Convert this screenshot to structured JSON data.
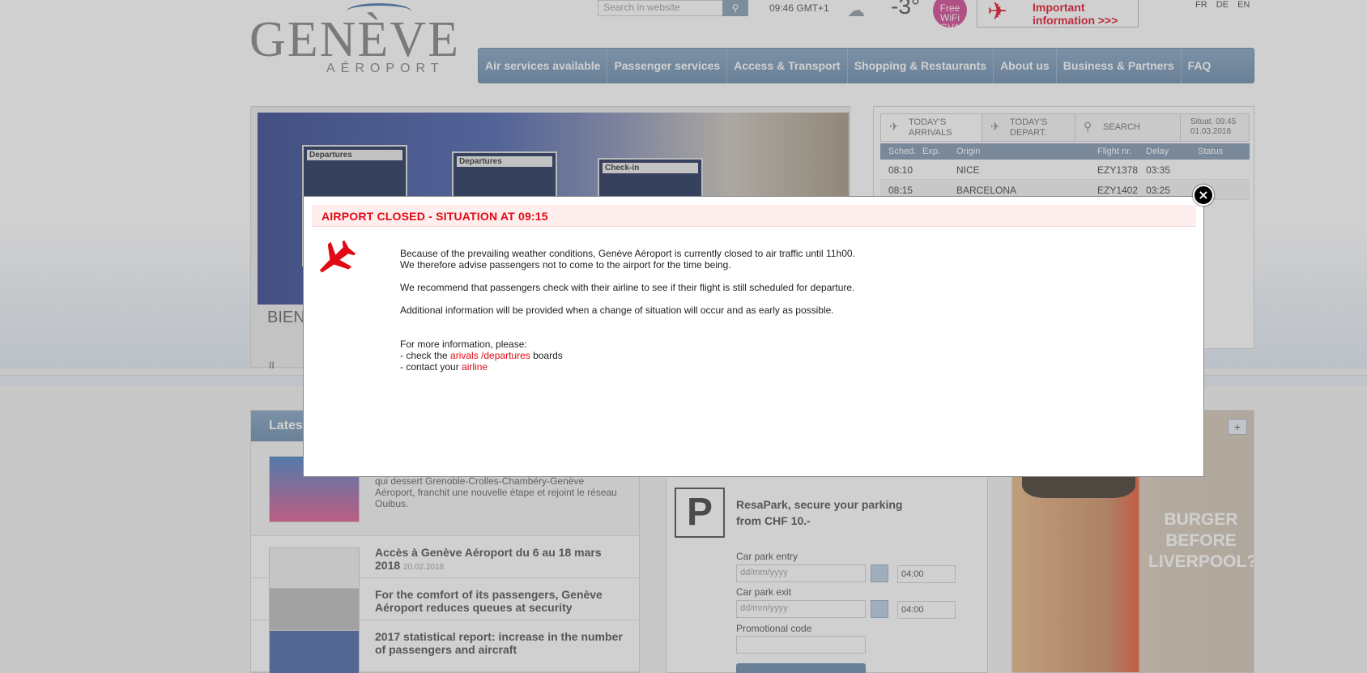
{
  "header": {
    "logo_main": "GENÈVE",
    "logo_sub": "AÉROPORT",
    "search_placeholder": "Search in website",
    "clock": "09:46 GMT+1",
    "temperature": "-3°",
    "wifi_label": "Free WiFi GVA",
    "important_info": "Important information >>>",
    "languages": [
      "FR",
      "DE",
      "EN"
    ]
  },
  "nav": {
    "items": [
      "Air services available",
      "Passenger services",
      "Access & Transport",
      "Shopping & Restaurants",
      "About us",
      "Business & Partners",
      "FAQ"
    ]
  },
  "hero": {
    "board_labels": [
      "Departures",
      "Departures",
      "Check-in"
    ],
    "caption": "BIEN",
    "pause_label": "II"
  },
  "flights": {
    "tab_arrivals": "TODAY'S ARRIVALS",
    "tab_departures": "TODAY'S DEPART.",
    "tab_search": "SEARCH",
    "situation": "Situat. 09:45 01.03.2018",
    "columns": [
      "Sched.",
      "Exp.",
      "Origin",
      "Flight nr.",
      "Delay",
      "Status"
    ],
    "rows": [
      {
        "sched": "08:10",
        "exp": "",
        "origin": "NICE",
        "flight": "EZY1378",
        "delay": "03:35",
        "status": ""
      },
      {
        "sched": "08:15",
        "exp": "",
        "origin": "BARCELONA",
        "flight": "EZY1402",
        "delay": "03:25",
        "status": ""
      }
    ]
  },
  "news": {
    "heading": "Latest",
    "items": [
      {
        "title": "",
        "date": "",
        "text": "qui dessert Grenoble-Crolles-Chambéry-Genève Aéroport, franchit une nouvelle étape et rejoint le réseau Ouibus."
      },
      {
        "title": "Accès à Genève Aéroport du 6 au 18 mars 2018",
        "date": "20.02.2018",
        "text": ""
      },
      {
        "title": "For the comfort of its passengers, Genève Aéroport reduces queues at security",
        "date": "",
        "text": ""
      },
      {
        "title": "2017 statistical report: increase in the number of passengers and aircraft",
        "date": "",
        "text": ""
      }
    ]
  },
  "parking": {
    "title": "ResaPark, secure your parking from CHF 10.-",
    "entry_label": "Car park entry",
    "exit_label": "Car park exit",
    "date_placeholder": "dd/mm/yyyy",
    "time_value": "04:00",
    "promo_label": "Promotional code"
  },
  "ad": {
    "text": "BURGER BEFORE LIVERPOOL?"
  },
  "modal": {
    "title": "AIRPORT CLOSED - SITUATION AT 09:15",
    "para1_line1": "Because of the prevailing weather conditions, Genève Aéroport is currently closed to air traffic until 11h00.",
    "para1_line2": "We therefore advise passengers not to come to the airport for the time being.",
    "para2": "We recommend that passengers check with their airline to see if their flight is still scheduled for departure.",
    "para3": "Additional information will be provided when a change of situation will occur and as early as possible.",
    "more_info": "For more information, please:",
    "check_prefix": "- check the ",
    "check_link": "arivals /departures",
    "check_suffix": " boards",
    "contact_prefix": "- contact your ",
    "contact_link": "airline",
    "close_symbol": "×"
  },
  "colors": {
    "accent_red": "#e10a14",
    "nav_blue": "#6285a8",
    "modal_header_bg": "#ffeeee"
  }
}
